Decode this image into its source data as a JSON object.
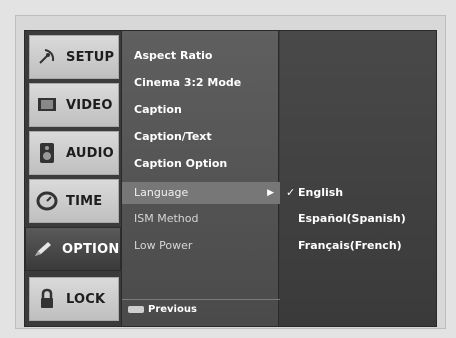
{
  "sidebar": {
    "items": [
      {
        "label": "SETUP",
        "icon": "satellite-dish-icon"
      },
      {
        "label": "VIDEO",
        "icon": "tv-screen-icon"
      },
      {
        "label": "AUDIO",
        "icon": "speaker-icon"
      },
      {
        "label": "TIME",
        "icon": "clock-icon"
      },
      {
        "label": "OPTION",
        "icon": "pencil-icon"
      },
      {
        "label": "LOCK",
        "icon": "padlock-icon"
      }
    ],
    "active": "OPTION"
  },
  "menu": {
    "items": [
      {
        "label": "Aspect Ratio"
      },
      {
        "label": "Cinema 3:2 Mode"
      },
      {
        "label": "Caption"
      },
      {
        "label": "Caption/Text"
      },
      {
        "label": "Caption Option"
      },
      {
        "label": "Language"
      },
      {
        "label": "ISM Method"
      },
      {
        "label": "Low Power"
      }
    ],
    "selected": "Language",
    "previous_label": "Previous"
  },
  "submenu": {
    "items": [
      {
        "label": "English",
        "checked": true
      },
      {
        "label": "Español(Spanish)",
        "checked": false
      },
      {
        "label": "Français(French)",
        "checked": false
      }
    ]
  },
  "colors": {
    "active_tab_bg": "#4a4a4a",
    "menu_bg": "#555555",
    "selected_row_bg": "#777777",
    "submenu_bg": "#424242",
    "tab_bg": "#cfcfcf"
  }
}
